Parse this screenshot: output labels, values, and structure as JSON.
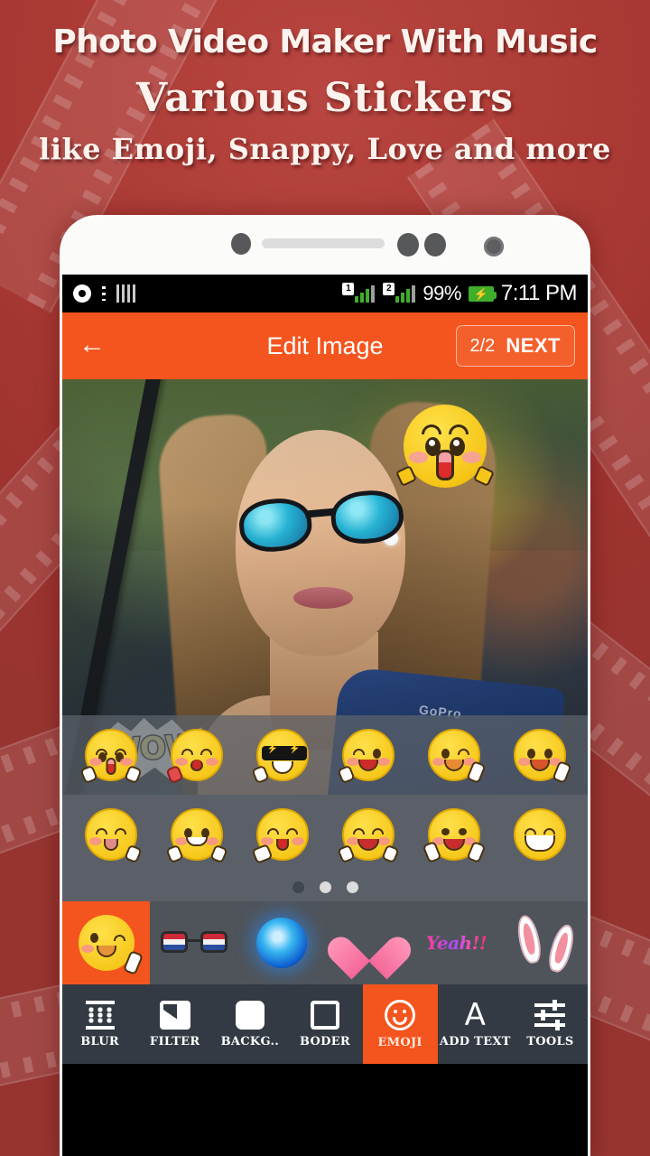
{
  "promo": {
    "headline_1": "Photo Video Maker With Music",
    "headline_2": "Various Stickers",
    "headline_3": "like Emoji, Snappy, Love and more",
    "background_color": "#a93b36"
  },
  "statusbar": {
    "disc_icon": "disc-icon",
    "bars_icon": "bars-icon",
    "sim1_label": "1",
    "sim2_label": "2",
    "battery_percent": "99%",
    "battery_icon": "battery-charging-icon",
    "bolt_glyph": "⚡",
    "clock": "7:11 PM"
  },
  "appbar": {
    "back_glyph": "←",
    "title": "Edit Image",
    "next_count": "2/2",
    "next_label": "NEXT",
    "accent_color": "#f4541d"
  },
  "canvas": {
    "sticker_emoji_name": "surprised-emoji-sticker",
    "sticker_wow_text": "WOW",
    "photo_brand_text": "GoPro"
  },
  "picker": {
    "row_1": [
      {
        "name": "emoji-surprised-hands"
      },
      {
        "name": "emoji-kiss-blush"
      },
      {
        "name": "emoji-sunglasses-cool"
      },
      {
        "name": "emoji-dizzy-shout"
      },
      {
        "name": "emoji-wink-peace"
      },
      {
        "name": "emoji-thumbs-up-laugh"
      }
    ],
    "row_2": [
      {
        "name": "emoji-shy-smirk"
      },
      {
        "name": "emoji-point-smile"
      },
      {
        "name": "emoji-fan-sweat"
      },
      {
        "name": "emoji-laugh-tears"
      },
      {
        "name": "emoji-double-peace"
      },
      {
        "name": "emoji-grin-teeth"
      }
    ],
    "page_dots": [
      {
        "active": true
      },
      {
        "active": false
      },
      {
        "active": false
      }
    ]
  },
  "categories": [
    {
      "name": "category-emoji",
      "selected": true
    },
    {
      "name": "category-glasses",
      "selected": false
    },
    {
      "name": "category-orb",
      "selected": false
    },
    {
      "name": "category-heart",
      "selected": false
    },
    {
      "name": "category-yeah",
      "selected": false,
      "label": "Yeah!!"
    },
    {
      "name": "category-bunny-ears",
      "selected": false
    }
  ],
  "tabbar": {
    "items": [
      {
        "label": "BLUR",
        "icon": "blur-icon",
        "active": false
      },
      {
        "label": "FILTER",
        "icon": "filter-icon",
        "active": false
      },
      {
        "label": "BACKG..",
        "icon": "background-icon",
        "active": false
      },
      {
        "label": "BODER",
        "icon": "border-icon",
        "active": false
      },
      {
        "label": "EMOJI",
        "icon": "emoji-icon",
        "active": true
      },
      {
        "label": "ADD TEXT",
        "icon": "text-icon",
        "active": false,
        "glyph": "A"
      },
      {
        "label": "TOOLS",
        "icon": "tools-icon",
        "active": false
      }
    ]
  }
}
